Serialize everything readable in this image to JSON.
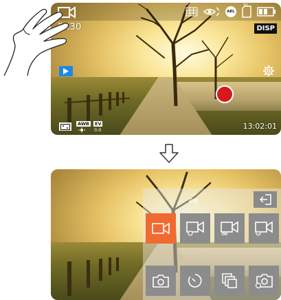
{
  "screen1": {
    "resolution_label": "5K30",
    "disp_label": "DISP",
    "time": "13:02:01",
    "storage_badge": "SD",
    "wb_badge": "AWB",
    "ev_badge": "EV",
    "ev_value": "0.0",
    "icons": [
      "video-camera-icon",
      "grid-icon",
      "eye-icon",
      "ael-icon",
      "sd-card-icon",
      "battery-icon",
      "settings-gear-icon",
      "play-icon",
      "record-button",
      "focus-icon"
    ]
  },
  "screen2": {
    "menu_title": "录像",
    "tiles_row1": [
      "video-mode-icon",
      "video-timelapse-icon",
      "video-loop-icon",
      "video-slowmotion-icon"
    ],
    "tiles_row2": [
      "photo-icon",
      "timer-icon",
      "burst-icon",
      "photo-timelapse-icon"
    ],
    "active_tile": "video-mode-icon"
  },
  "colors": {
    "accent": "#f06a32",
    "record": "#d61a1a",
    "play": "#1e88e5",
    "tile": "#8c8c8c"
  }
}
